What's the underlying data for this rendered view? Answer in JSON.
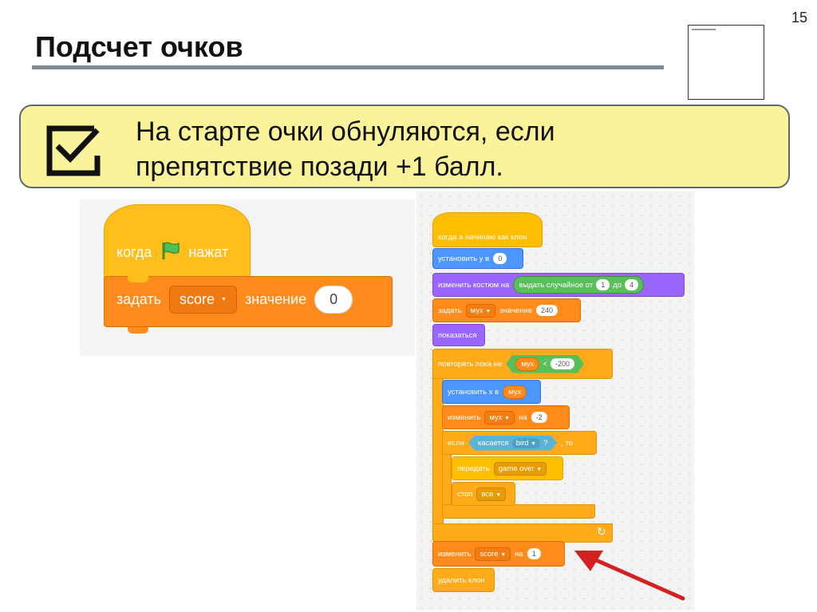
{
  "slide": {
    "number": "15",
    "title": "Подсчет очков",
    "callout_text": "На старте очки обнуляются, если\nпрепятствие позади +1 балл."
  },
  "left_script": {
    "hat_when": "когда",
    "hat_clicked": "нажат",
    "set_label": "задать",
    "set_var": "score",
    "set_value_label": "значение",
    "set_value": "0"
  },
  "right_script": {
    "clone_start": "когда я начинаю как клон",
    "set_y_label": "установить у в",
    "set_y_value": "0",
    "switch_costume": "изменить костюм на",
    "random_label": "выдать случайное от",
    "random_from": "1",
    "random_to_label": "до",
    "random_to": "4",
    "set_label": "задать",
    "var_myx": "мух",
    "value_label": "значение",
    "value_240": "240",
    "show": "показаться",
    "repeat_until": "повторять пока не",
    "lt": "<",
    "value_m200": "-200",
    "set_x_label": "установить х в",
    "change_label": "изменить",
    "by_label": "на",
    "value_m2": "-2",
    "if_label": "если",
    "touching_label": "касается",
    "bird": "bird",
    "question": "?",
    "then_label": ", то",
    "broadcast_label": "передать",
    "broadcast_msg": "game over",
    "stop_label": "стоп",
    "stop_all": "все",
    "score": "score",
    "value_1": "1",
    "delete_clone": "удалить клон",
    "loop_arrow": "↻"
  },
  "colors": {
    "callout_bg": "#fbf39a",
    "control": "#ffab19",
    "motion": "#4c97ff",
    "looks": "#9966ff",
    "variables": "#ff8c1a",
    "operators": "#59c059",
    "sensing": "#5cb1d6",
    "arrow": "#d42020"
  },
  "icons": {
    "callout": "checkbox-icon",
    "green_flag": "green-flag-icon",
    "pointer": "red-arrow-icon"
  }
}
